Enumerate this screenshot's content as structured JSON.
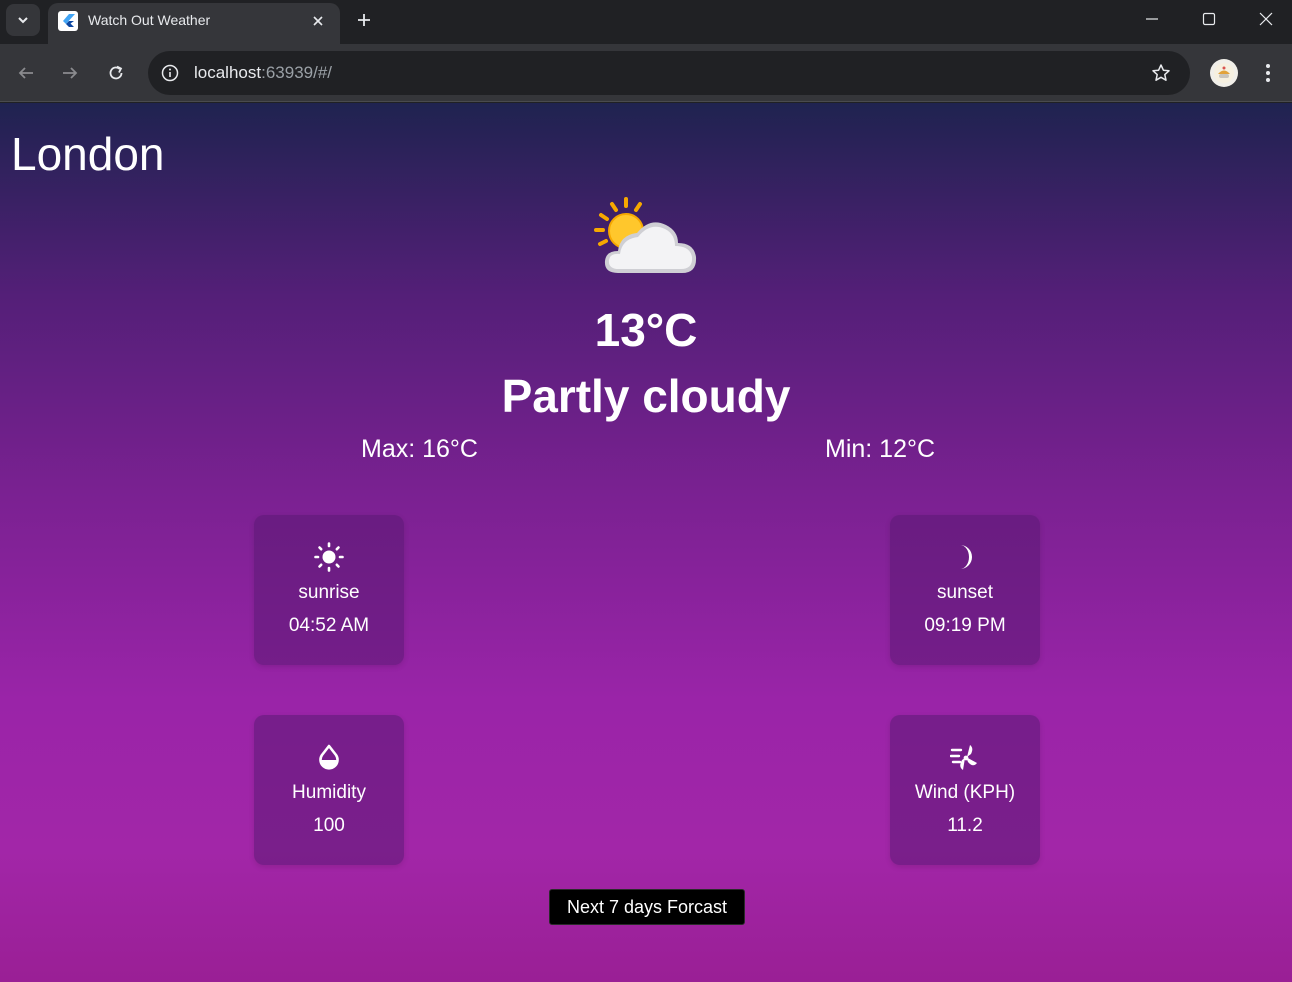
{
  "browser": {
    "tab_title": "Watch Out Weather",
    "url_host": "localhost",
    "url_rest": ":63939/#/"
  },
  "app": {
    "city": "London",
    "temperature": "13°C",
    "condition": "Partly cloudy",
    "max": "Max: 16°C",
    "min": "Min: 12°C",
    "cards": {
      "sunrise": {
        "label": "sunrise",
        "value": "04:52 AM",
        "icon": "sun-icon"
      },
      "sunset": {
        "label": "sunset",
        "value": "09:19 PM",
        "icon": "moon-icon"
      },
      "humidity": {
        "label": "Humidity",
        "value": "100",
        "icon": "water-drop-icon"
      },
      "wind": {
        "label": "Wind (KPH)",
        "value": "11.2",
        "icon": "wind-icon"
      }
    },
    "forecast_button": "Next 7 days Forcast"
  },
  "colors": {
    "gradient_top": "#1f2350",
    "gradient_mid": "#7b2192",
    "gradient_bottom": "#a226a8",
    "card_bg": "rgba(90,25,115,0.55)",
    "button_bg": "#000000"
  }
}
